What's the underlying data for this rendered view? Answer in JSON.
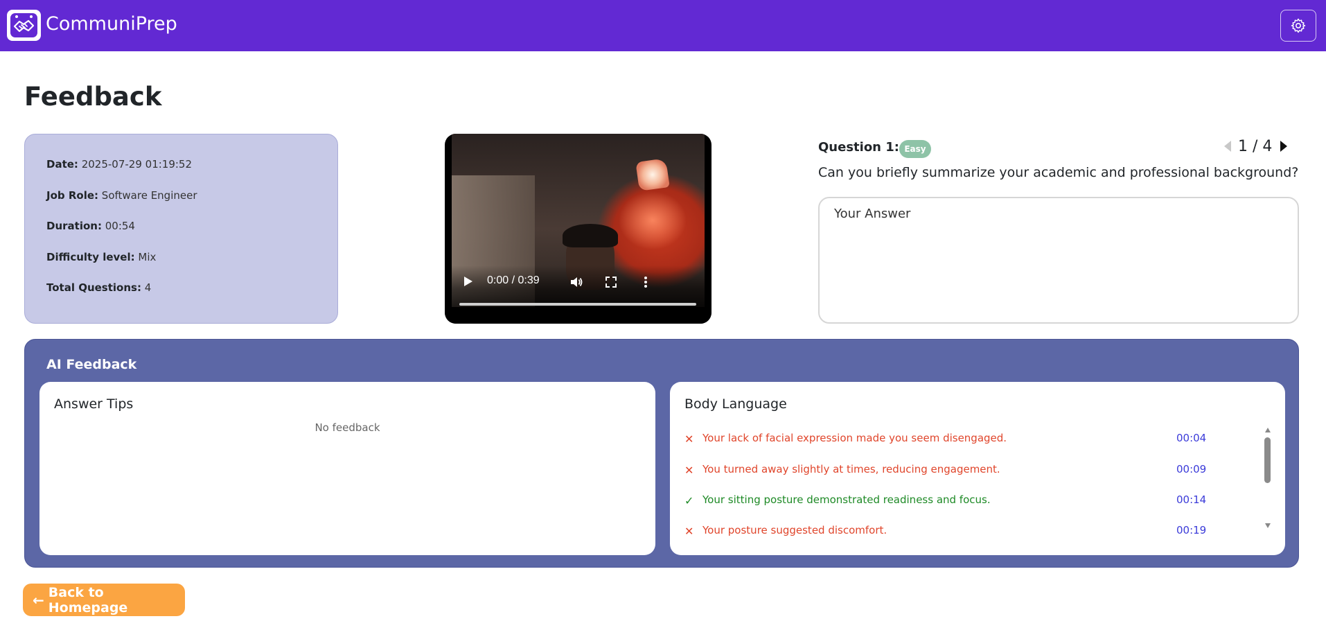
{
  "header": {
    "brand": "CommuniPrep",
    "logo_icon": "handshake-icon",
    "settings_icon": "gear-icon",
    "bar_color": "#6229d3"
  },
  "page": {
    "title": "Feedback"
  },
  "session": {
    "date_label": "Date:",
    "date_value": "2025-07-29 01:19:52",
    "role_label": "Job Role:",
    "role_value": "Software Engineer",
    "duration_label": "Duration:",
    "duration_value": "00:54",
    "difficulty_label": "Difficulty level:",
    "difficulty_value": "Mix",
    "total_label": "Total Questions:",
    "total_value": "4"
  },
  "video": {
    "time": "0:00 / 0:39",
    "icons": [
      "play-icon",
      "volume-icon",
      "fullscreen-icon",
      "more-vert-icon"
    ],
    "progress": 0.0
  },
  "question": {
    "label": "Question 1:",
    "difficulty_badge": "Easy",
    "pager": "1 / 4",
    "text": "Can you briefly summarize your academic and professional background?",
    "answer_placeholder": "Your Answer"
  },
  "ai_feedback": {
    "title": "AI Feedback",
    "answer_tips": {
      "title": "Answer Tips",
      "empty": "No feedback"
    },
    "body_language": {
      "title": "Body Language",
      "items": [
        {
          "type": "negative",
          "icon": "cross-icon",
          "text": "Your lack of facial expression made you seem disengaged.",
          "time": "00:04"
        },
        {
          "type": "negative",
          "icon": "cross-icon",
          "text": "You turned away slightly at times, reducing engagement.",
          "time": "00:09"
        },
        {
          "type": "positive",
          "icon": "check-icon",
          "text": "Your sitting posture demonstrated readiness and focus.",
          "time": "00:14"
        },
        {
          "type": "negative",
          "icon": "cross-icon",
          "text": "Your posture suggested discomfort.",
          "time": "00:19"
        }
      ]
    }
  },
  "footer": {
    "back_label": "Back to Homepage",
    "back_icon": "arrow-left-icon"
  }
}
